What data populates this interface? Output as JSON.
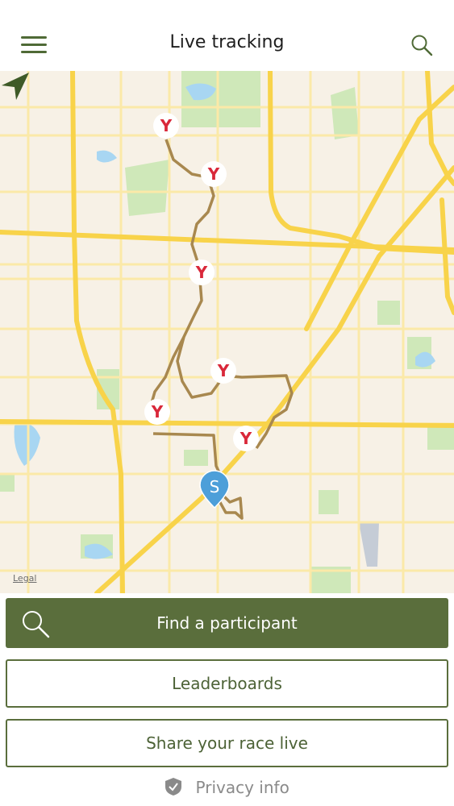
{
  "header": {
    "title": "Live tracking",
    "menu_icon": "hamburger-menu-icon",
    "search_icon": "search-icon"
  },
  "map": {
    "legal_label": "Legal",
    "locate_icon": "location-arrow-icon",
    "start_marker_label": "S",
    "checkpoint_icon": "y-checkpoint-icon",
    "colors": {
      "background": "#f7f1e6",
      "major_road": "#f8d34a",
      "minor_road": "#fbe9a8",
      "route": "#a8884f",
      "park": "#cfe8b9",
      "water": "#a8d6f2",
      "start_marker": "#4d9fd9"
    }
  },
  "actions": {
    "find_participant_label": "Find a participant",
    "leaderboards_label": "Leaderboards",
    "share_label": "Share your race live",
    "privacy_label": "Privacy info"
  },
  "theme": {
    "primary": "#5a6e3c",
    "primary_text": "#ffffff",
    "outline_text": "#4c6236"
  }
}
